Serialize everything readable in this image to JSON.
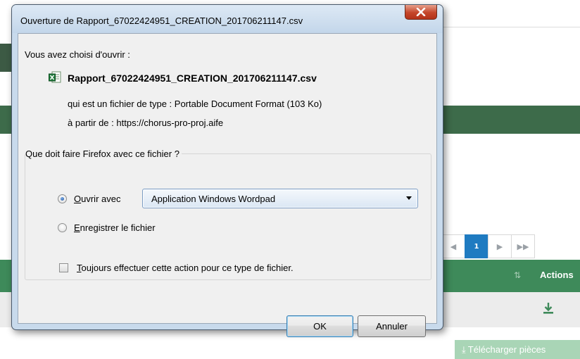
{
  "background": {
    "pager": {
      "first": "◀",
      "current": "1",
      "next": "▶",
      "last": "▶▶"
    },
    "table": {
      "actions_header": "Actions"
    },
    "download_button": "Télécharger pièces"
  },
  "dialog": {
    "title": "Ouverture de Rapport_67022424951_CREATION_201706211147.csv",
    "chosen_label": "Vous avez choisi d'ouvrir :",
    "filename": "Rapport_67022424951_CREATION_201706211147.csv",
    "type_label": "qui est un fichier de type :",
    "type_value": "Portable Document Format (103 Ko)",
    "from_label": "à partir de :",
    "from_value": "https://chorus-pro-proj.aife",
    "question": "Que doit faire Firefox avec ce fichier ?",
    "open_with": {
      "accel": "O",
      "rest": "uvrir avec",
      "checked": true
    },
    "app_select": "Application Windows Wordpad",
    "save_file": {
      "accel": "E",
      "rest": "nregistrer le fichier",
      "checked": false
    },
    "always": {
      "accel": "T",
      "rest": "oujours effectuer cette action pour ce type de fichier.",
      "checked": false
    },
    "ok": "OK",
    "cancel": "Annuler"
  },
  "colors": {
    "accent_blue": "#1f7bc1",
    "table_green": "#3e8a5a",
    "close_red": "#c4462a"
  },
  "icons": [
    "close-icon",
    "csv-file-icon",
    "download-icon",
    "sort-icon",
    "chevron-down-icon"
  ]
}
